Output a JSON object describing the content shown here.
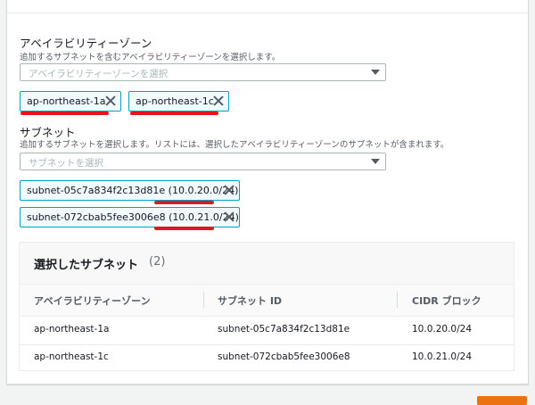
{
  "az_section": {
    "label": "アベイラビリティーゾーン",
    "description": "追加するサブネットを含むアベイラビリティーゾーンを選択します。",
    "placeholder": "アベイラビリティーゾーンを選択",
    "tokens": [
      "ap-northeast-1a",
      "ap-northeast-1c"
    ]
  },
  "subnet_section": {
    "label": "サブネット",
    "description": "追加するサブネットを選択します。リストには、選択したアベイラビリティーゾーンのサブネットが含まれます。",
    "placeholder": "サブネットを選択",
    "tokens": [
      {
        "id": "subnet-05c7a834f2c13d81e",
        "cidr": "(10.0.20.0/24)"
      },
      {
        "id": "subnet-072cbab5fee3006e8",
        "cidr": "(10.0.21.0/24)"
      }
    ]
  },
  "selected_table": {
    "title": "選択したサブネット",
    "count": "(2)",
    "columns": [
      "アベイラビリティーゾーン",
      "サブネット ID",
      "CIDR ブロック"
    ],
    "rows": [
      {
        "az": "ap-northeast-1a",
        "subnet": "subnet-05c7a834f2c13d81e",
        "cidr": "10.0.20.0/24"
      },
      {
        "az": "ap-northeast-1c",
        "subnet": "subnet-072cbab5fee3006e8",
        "cidr": "10.0.21.0/24"
      }
    ]
  },
  "colors": {
    "token_border": "#00a1c9",
    "token_bg": "#f1faff",
    "annotation_red": "#e3161b",
    "primary_button": "#ec7211"
  }
}
